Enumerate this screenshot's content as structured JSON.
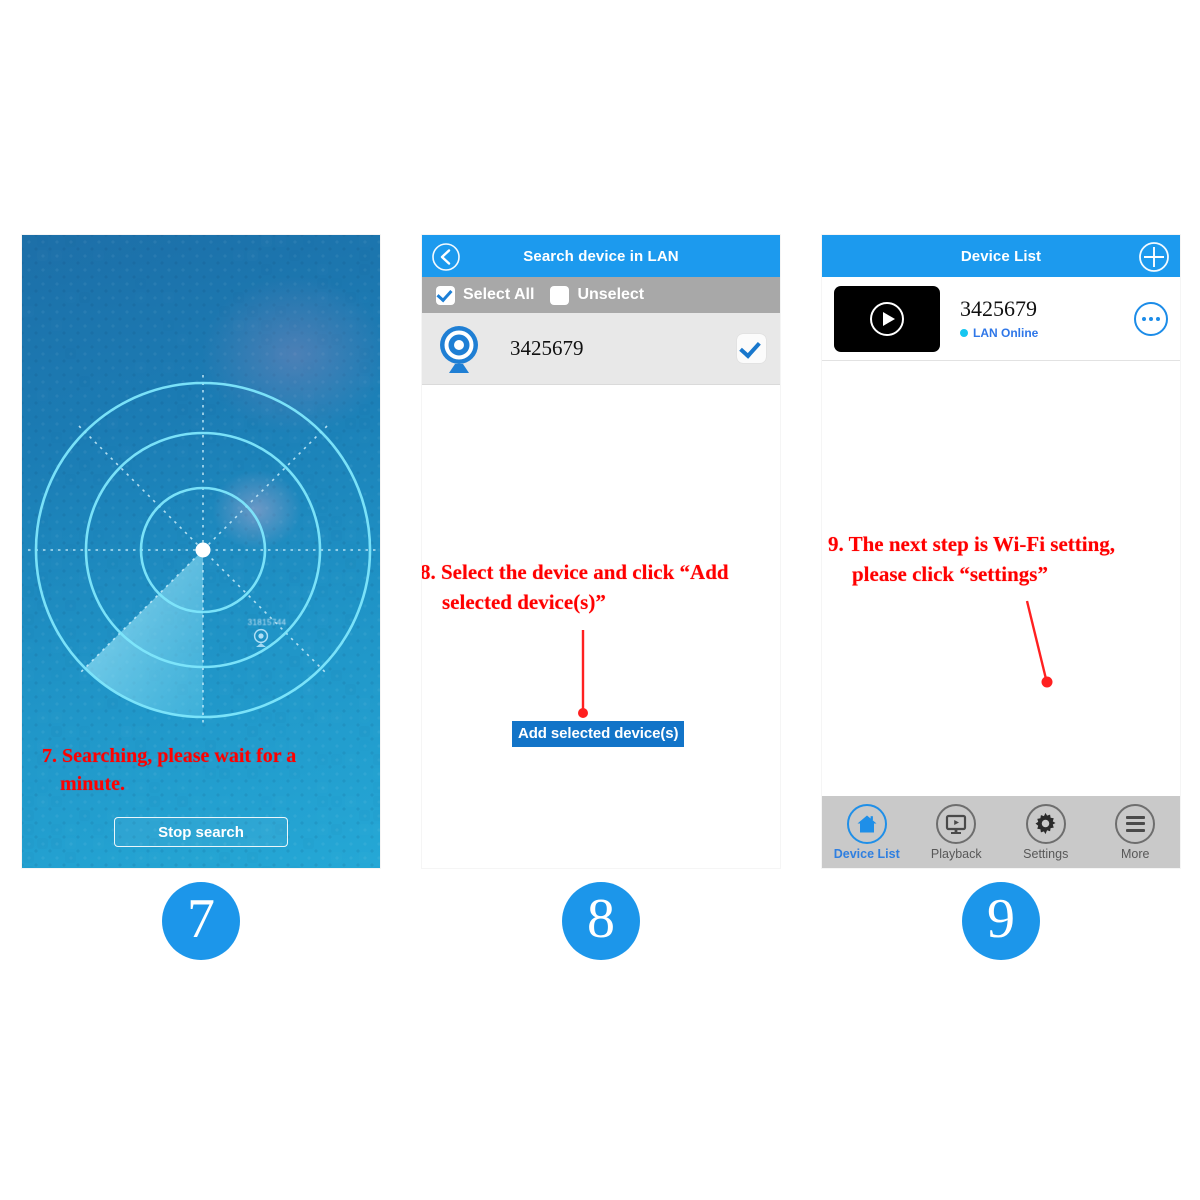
{
  "colors": {
    "accent_blue": "#1c9aee",
    "badge_blue": "#1c96ea",
    "annotation_red": "#ff0000",
    "select_bar_gray": "#a8a8a8",
    "tab_bar_gray": "#c9c9c9",
    "status_cyan": "#16c6f0",
    "status_text_blue": "#2f77e8",
    "add_button_blue": "#1274c8"
  },
  "steps": {
    "seven": "7",
    "eight": "8",
    "nine": "9"
  },
  "panel7": {
    "device_label": "31815744",
    "device_icon": "webcam-icon",
    "annotation_line1": "7. Searching, please wait for a",
    "annotation_line2": "minute.",
    "stop_button": "Stop search"
  },
  "panel8": {
    "nav": {
      "back_icon": "chevron-left-circle-icon",
      "title": "Search device in LAN"
    },
    "select_bar": {
      "select_all_label": "Select All",
      "select_all_checked": true,
      "unselect_label": "Unselect",
      "unselect_checked": false
    },
    "device": {
      "icon": "webcam-icon",
      "name": "3425679",
      "checked": true
    },
    "annotation_line1": "8. Select the device and click “Add",
    "annotation_line2": "selected device(s)”",
    "add_button": "Add selected device(s)"
  },
  "panel9": {
    "nav": {
      "title": "Device List",
      "add_icon": "plus-circle-icon"
    },
    "device": {
      "thumbnail_icon": "play-circle-icon",
      "name": "3425679",
      "status": "LAN Online",
      "more_icon": "ellipsis-circle-icon"
    },
    "annotation_line1": "9. The next step is Wi-Fi setting,",
    "annotation_line2": "please click “settings”",
    "tabs": [
      {
        "label": "Device List",
        "icon": "home-icon",
        "active": true
      },
      {
        "label": "Playback",
        "icon": "monitor-play-icon",
        "active": false
      },
      {
        "label": "Settings",
        "icon": "gear-icon",
        "active": false
      },
      {
        "label": "More",
        "icon": "hamburger-icon",
        "active": false
      }
    ]
  }
}
